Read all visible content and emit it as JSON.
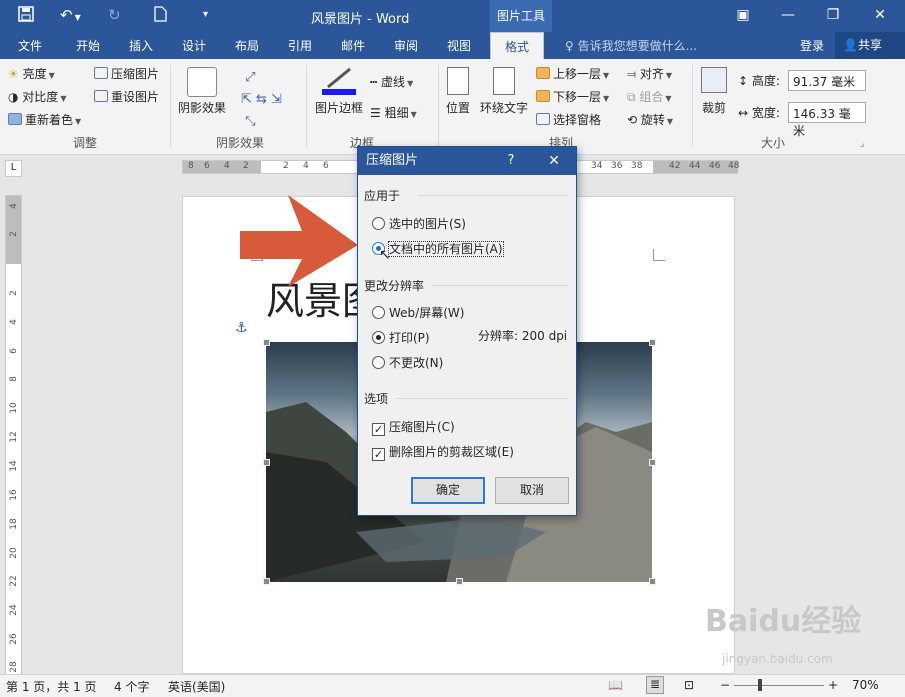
{
  "titlebar": {
    "doc_title": "风景图片 - Word",
    "context_tools": "图片工具",
    "qat_save_icon": "save-icon",
    "qat_undo_icon": "undo-icon",
    "qat_redo_icon": "redo-icon",
    "qat_new_icon": "new-document-icon"
  },
  "tabs": [
    "文件",
    "开始",
    "插入",
    "设计",
    "布局",
    "引用",
    "邮件",
    "审阅",
    "视图",
    "格式"
  ],
  "active_tab": "格式",
  "tellme": "告诉我您想要做什么...",
  "login": "登录",
  "share": "共享",
  "ribbon": {
    "adjust": {
      "brightness": "亮度",
      "contrast": "对比度",
      "recolor": "重新着色",
      "compress": "压缩图片",
      "reset": "重设图片",
      "group": "调整"
    },
    "shadow": {
      "shadow_effects": "阴影效果",
      "group": "阴影效果"
    },
    "border": {
      "picture_border": "图片边框",
      "dashes": "虚线",
      "weight": "粗细",
      "group": "边框"
    },
    "arrange": {
      "position": "位置",
      "wrap": "环绕文字",
      "bring_forward": "上移一层",
      "send_backward": "下移一层",
      "selection_pane": "选择窗格",
      "align": "对齐",
      "group_btn": "组合",
      "rotate": "旋转",
      "group": "排列"
    },
    "size": {
      "crop": "裁剪",
      "height_label": "高度:",
      "height_value": "91.37 毫米",
      "width_label": "宽度:",
      "width_value": "146.33 毫米",
      "group": "大小"
    }
  },
  "ruler": {
    "h_labels": [
      "8",
      "6",
      "4",
      "2",
      "2",
      "4",
      "6",
      "34",
      "36",
      "38",
      "42",
      "44",
      "46",
      "48"
    ],
    "v_labels": [
      "4",
      "2",
      "2",
      "4",
      "6",
      "8",
      "10",
      "12",
      "14",
      "16",
      "18",
      "20",
      "22",
      "24",
      "26",
      "28"
    ]
  },
  "document": {
    "heading": "风景图",
    "image_alt": "landscape-mountain-lake-picture"
  },
  "dialog": {
    "title": "压缩图片",
    "help": "?",
    "apply_to_label": "应用于",
    "apply_selected": "选中的图片(S)",
    "apply_all": "文档中的所有图片(A)",
    "resolution_label": "更改分辨率",
    "res_web": "Web/屏幕(W)",
    "res_print": "打印(P)",
    "res_nochange": "不更改(N)",
    "resolution_info": "分辨率:  200 dpi",
    "options_label": "选项",
    "opt_compress": "压缩图片(C)",
    "opt_delete_crop": "删除图片的剪裁区域(E)",
    "ok": "确定",
    "cancel": "取消"
  },
  "status": {
    "page": "第 1 页，共 1 页",
    "words": "4 个字",
    "language": "英语(美国)",
    "zoom": "70%"
  },
  "watermark": {
    "logo": "Baidu经验",
    "url": "jingyan.baidu.com"
  },
  "colors": {
    "accent": "#2b579a",
    "arrow": "#d75a3a"
  }
}
